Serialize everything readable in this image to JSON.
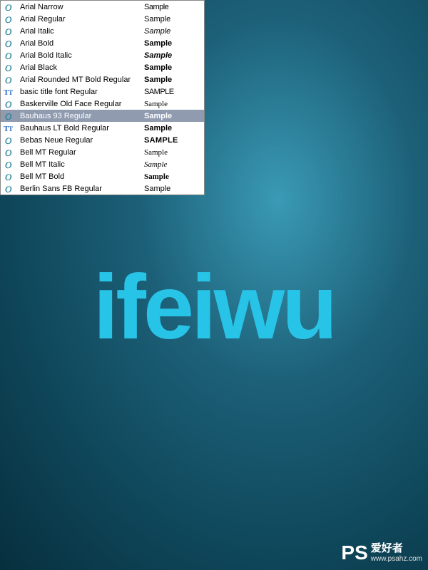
{
  "fonts": [
    {
      "name": "Arial Narrow",
      "sample": "Sample",
      "icon": "o",
      "style": "s-narrow"
    },
    {
      "name": "Arial Regular",
      "sample": "Sample",
      "icon": "o",
      "style": ""
    },
    {
      "name": "Arial Italic",
      "sample": "Sample",
      "icon": "o",
      "style": "s-italic"
    },
    {
      "name": "Arial Bold",
      "sample": "Sample",
      "icon": "o",
      "style": "s-bold"
    },
    {
      "name": "Arial Bold Italic",
      "sample": "Sample",
      "icon": "o",
      "style": "s-bolditalic"
    },
    {
      "name": "Arial Black",
      "sample": "Sample",
      "icon": "o",
      "style": "s-black"
    },
    {
      "name": "Arial Rounded MT Bold Regular",
      "sample": "Sample",
      "icon": "o",
      "style": "s-bold"
    },
    {
      "name": "basic title font Regular",
      "sample": "SAMPLE",
      "icon": "tt",
      "style": "s-narrow"
    },
    {
      "name": "Baskerville Old Face Regular",
      "sample": "Sample",
      "icon": "o",
      "style": "s-serif"
    },
    {
      "name": "Bauhaus 93 Regular",
      "sample": "Sample",
      "icon": "o",
      "style": "s-bold",
      "selected": true
    },
    {
      "name": "Bauhaus LT Bold Regular",
      "sample": "Sample",
      "icon": "tt",
      "style": "s-bold"
    },
    {
      "name": "Bebas Neue Regular",
      "sample": "SAMPLE",
      "icon": "o",
      "style": "s-condensed"
    },
    {
      "name": "Bell MT Regular",
      "sample": "Sample",
      "icon": "o",
      "style": "s-serif"
    },
    {
      "name": "Bell MT Italic",
      "sample": "Sample",
      "icon": "o",
      "style": "s-serifitalic"
    },
    {
      "name": "Bell MT Bold",
      "sample": "Sample",
      "icon": "o",
      "style": "s-serif s-bold"
    },
    {
      "name": "Berlin Sans FB Regular",
      "sample": "Sample",
      "icon": "o",
      "style": ""
    }
  ],
  "canvas": {
    "text": "ifeiwu"
  },
  "watermark": {
    "logo": "PS",
    "top": "爱好者",
    "bottom": "www.psahz.com"
  }
}
